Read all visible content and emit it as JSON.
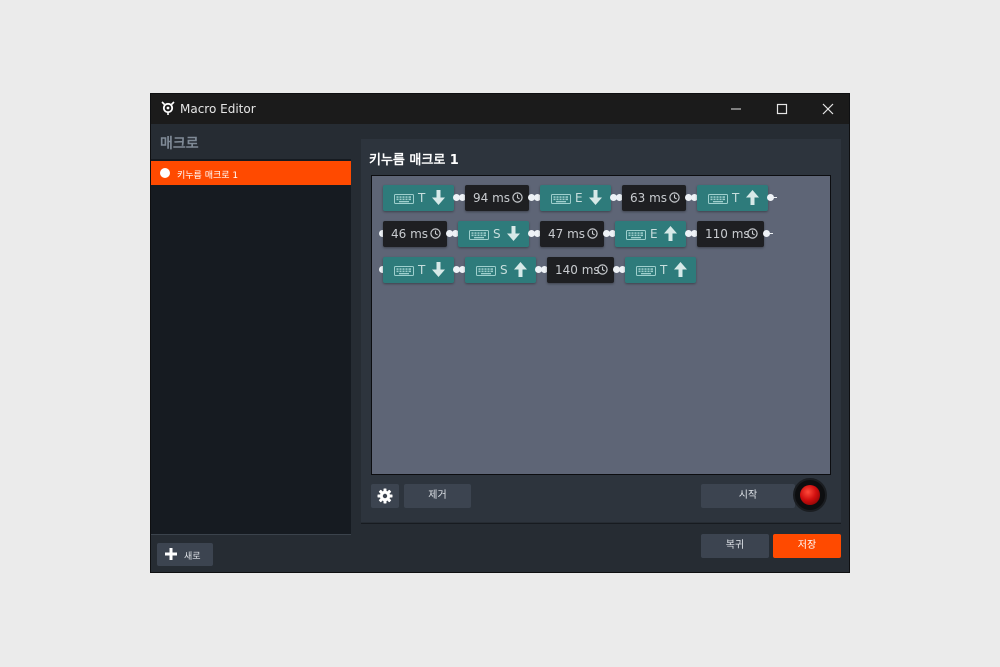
{
  "window": {
    "title": "Macro Editor"
  },
  "sidebar": {
    "header": "매크로",
    "items": [
      {
        "label": "키누름 매크로 1"
      }
    ],
    "new_button": "새로"
  },
  "editor": {
    "macro_title": "키누름 매크로 1",
    "rows": [
      [
        {
          "kind": "key",
          "key": "T",
          "dir": "down"
        },
        {
          "kind": "delay",
          "label": "94 ms"
        },
        {
          "kind": "key",
          "key": "E",
          "dir": "down"
        },
        {
          "kind": "delay",
          "label": "63 ms"
        },
        {
          "kind": "key",
          "key": "T",
          "dir": "up"
        }
      ],
      [
        {
          "kind": "delay",
          "label": "46 ms"
        },
        {
          "kind": "key",
          "key": "S",
          "dir": "down"
        },
        {
          "kind": "delay",
          "label": "47 ms"
        },
        {
          "kind": "key",
          "key": "E",
          "dir": "up"
        },
        {
          "kind": "delay",
          "label": "110 ms"
        }
      ],
      [
        {
          "kind": "key",
          "key": "T",
          "dir": "down"
        },
        {
          "kind": "key",
          "key": "S",
          "dir": "up"
        },
        {
          "kind": "delay",
          "label": "140 ms"
        },
        {
          "kind": "key",
          "key": "T",
          "dir": "up"
        }
      ]
    ],
    "icons": {
      "key": "keyboard-icon",
      "delay": "clock-icon",
      "settings": "gear-icon"
    },
    "remove_button": "제거",
    "start_button": "시작"
  },
  "footer": {
    "cancel_button": "복귀",
    "save_button": "저장"
  },
  "colors": {
    "accent": "#ff4a00",
    "key_node": "#2e7b7b",
    "delay_node": "#1e1f22",
    "canvas": "#5e6576"
  }
}
